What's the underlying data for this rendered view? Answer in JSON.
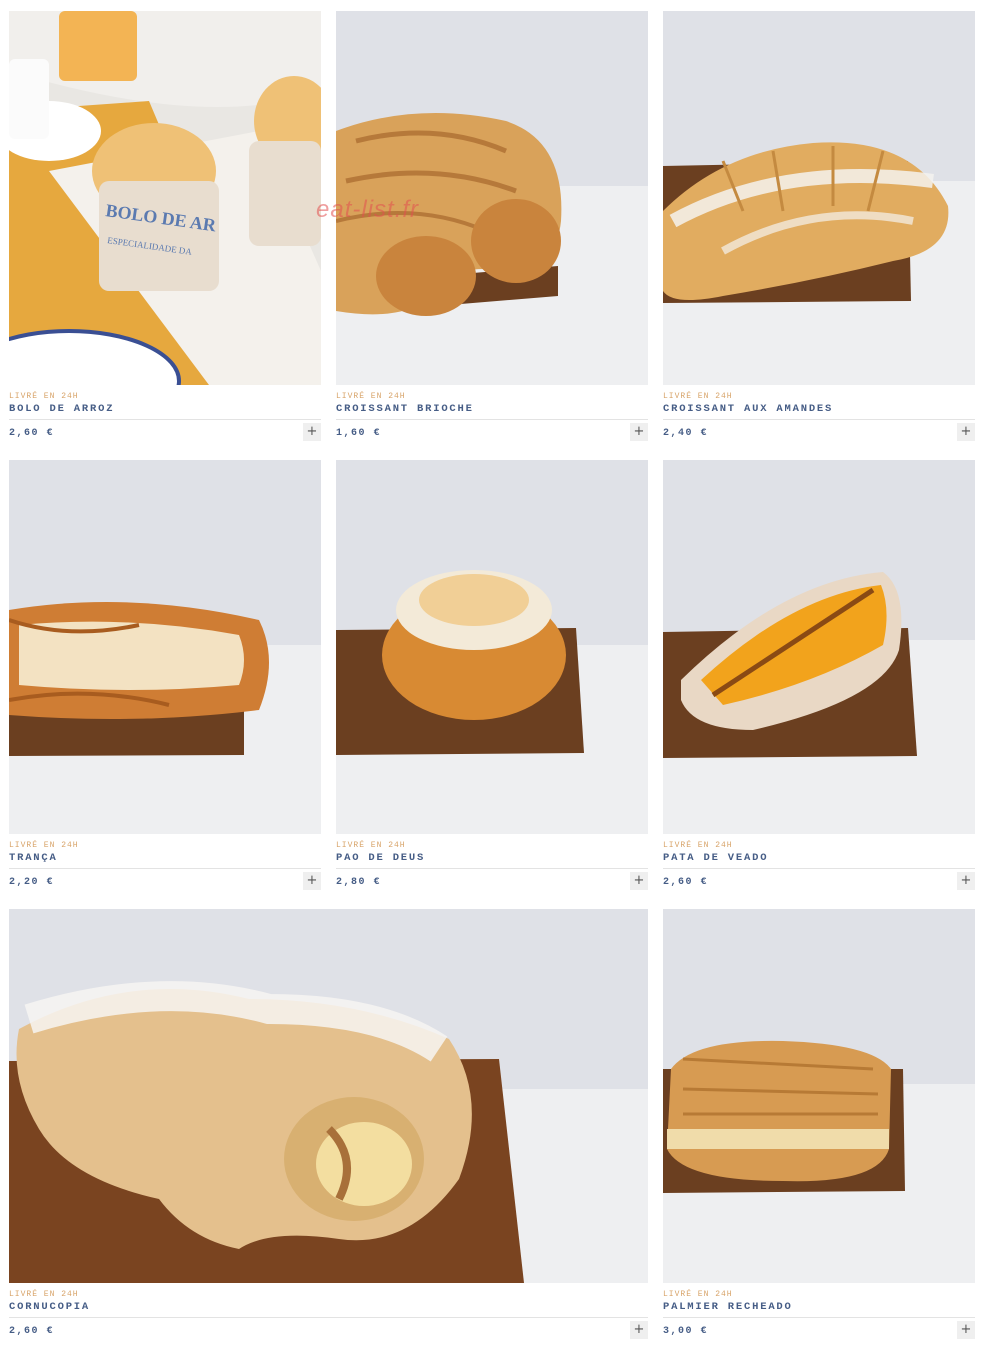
{
  "watermark": "eat-list.fr",
  "products": [
    {
      "delivery": "LIVRÉ EN 24H",
      "name": "BOLO DE ARROZ",
      "price": "2,60 €",
      "add": "+",
      "wrapper_text": "BOLO DE AR",
      "wrapper_sub": "ESPECIALIDADE DA"
    },
    {
      "delivery": "LIVRÉ EN 24H",
      "name": "CROISSANT BRIOCHE",
      "price": "1,60 €",
      "add": "+"
    },
    {
      "delivery": "LIVRÉ EN 24H",
      "name": "CROISSANT AUX AMANDES",
      "price": "2,40 €",
      "add": "+"
    },
    {
      "delivery": "LIVRÉ EN 24H",
      "name": "TRANÇA",
      "price": "2,20 €",
      "add": "+"
    },
    {
      "delivery": "LIVRÉ EN 24H",
      "name": "PAO DE DEUS",
      "price": "2,80 €",
      "add": "+"
    },
    {
      "delivery": "LIVRÉ EN 24H",
      "name": "PATA DE VEADO",
      "price": "2,60 €",
      "add": "+"
    },
    {
      "delivery": "LIVRÉ EN 24H",
      "name": "CORNUCOPIA",
      "price": "2,60 €",
      "add": "+"
    },
    {
      "delivery": "LIVRÉ EN 24H",
      "name": "PALMIER RECHEADO",
      "price": "3,00 €",
      "add": "+"
    }
  ]
}
